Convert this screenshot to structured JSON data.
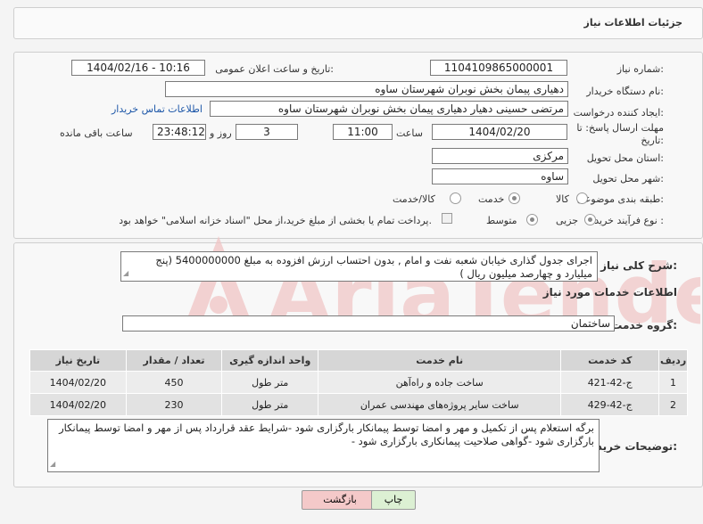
{
  "header": {
    "title": "جزئیات اطلاعات نیاز"
  },
  "form": {
    "need_number_label": "شماره نیاز:",
    "need_number": "1104109865000001",
    "announce_label": "تاریخ و ساعت اعلان عمومی:",
    "announce_value": "1404/02/16 - 10:16",
    "buyer_org_label": "نام دستگاه خریدار:",
    "buyer_org": "دهیاری پیمان بخش نوبران شهرستان ساوه",
    "creator_label": "ایجاد کننده درخواست:",
    "creator": "مرتضی حسینی دهیار دهیاری پیمان بخش نوبران شهرستان ساوه",
    "contact_link": "اطلاعات تماس خریدار",
    "deadline_label": "مهلت ارسال پاسخ: تا تاریخ:",
    "deadline_date": "1404/02/20",
    "time_label": "ساعت",
    "deadline_time": "11:00",
    "days_value": "3",
    "days_label": "روز و",
    "remaining_time": "23:48:12",
    "remaining_label": "ساعت باقی مانده",
    "province_label": "استان محل تحویل:",
    "province": "مرکزی",
    "city_label": "شهر محل تحویل:",
    "city": "ساوه",
    "category_label": "طبقه بندی موضوعی:",
    "category_options": [
      "کالا",
      "خدمت",
      "کالا/خدمت"
    ],
    "category_selected": "خدمت",
    "process_label": "نوع فرآیند خرید :",
    "process_options": [
      "جزیی",
      "متوسط"
    ],
    "process_selected": "جزیی",
    "payment_note": "پرداخت تمام یا بخشی از مبلغ خرید،از محل \"اسناد خزانه اسلامی\" خواهد بود."
  },
  "description": {
    "label": "شرح کلی نیاز:",
    "text": "اجرای جدول گذاری خیابان شعبه نفت و امام , بدون احتساب ارزش افزوده به مبلغ 5400000000 (پنج میلیارد و چهارصد میلیون ریال )"
  },
  "services": {
    "section_title": "اطلاعات خدمات مورد نیاز",
    "group_label": "گروه خدمت:",
    "group_value": "ساختمان",
    "columns": [
      "ردیف",
      "کد خدمت",
      "نام خدمت",
      "واحد اندازه گیری",
      "تعداد / مقدار",
      "تاریخ نیاز"
    ],
    "rows": [
      {
        "row": "1",
        "code": "ج-42-421",
        "name": "ساخت جاده و راه‌آهن",
        "unit": "متر طول",
        "qty": "450",
        "date": "1404/02/20"
      },
      {
        "row": "2",
        "code": "ج-42-429",
        "name": "ساخت سایر پروژه‌های مهندسی عمران",
        "unit": "متر طول",
        "qty": "230",
        "date": "1404/02/20"
      }
    ]
  },
  "buyer_notes": {
    "label": "توضیحات خریدار:",
    "text": "برگه استعلام پس از تکمیل و مهر و امضا توسط پیمانکار بارگزاری شود -شرایط عقد قرارداد پس از مهر و امضا توسط پیمانکار بارگزاری شود -گواهی صلاحیت پیمانکاری بارگزاری شود -"
  },
  "buttons": {
    "print": "چاپ",
    "back": "بازگشت"
  },
  "watermark_text": "AriaTender.neT",
  "colors": {
    "link": "#1d57a8",
    "back_button": "#f4c9c9",
    "print_button": "#dcf0d3",
    "watermark": "#f0c4c4"
  }
}
